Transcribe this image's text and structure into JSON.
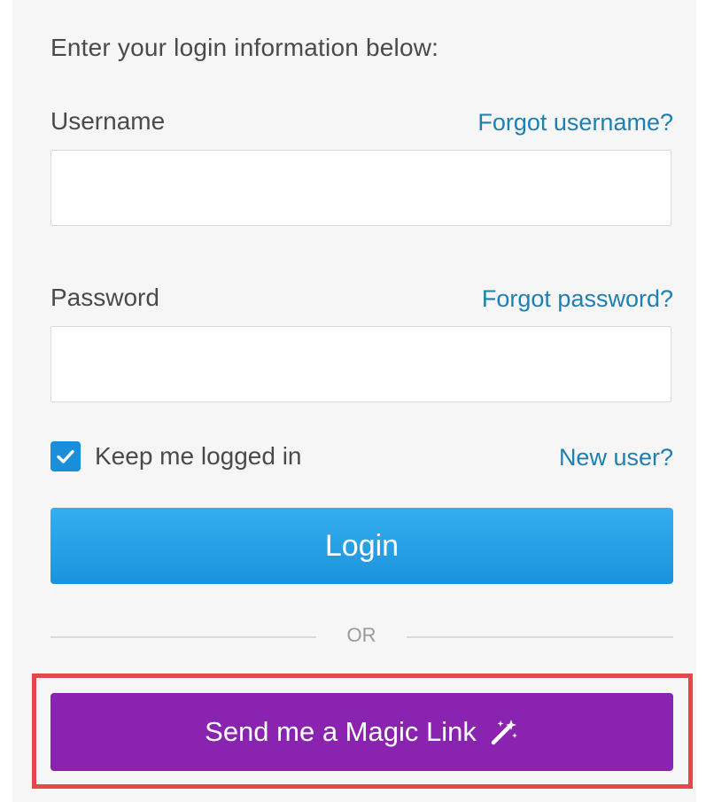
{
  "form": {
    "intro": "Enter your login information below:",
    "username": {
      "label": "Username",
      "forgot_link": "Forgot username?",
      "value": "",
      "placeholder": ""
    },
    "password": {
      "label": "Password",
      "forgot_link": "Forgot password?",
      "value": "",
      "placeholder": ""
    },
    "keep_logged_in": {
      "label": "Keep me logged in",
      "checked": true
    },
    "new_user_link": "New user?",
    "login_button": "Login",
    "divider_text": "OR",
    "magic_link_button": "Send me a Magic Link",
    "magic_icon": "magic-wand-icon"
  },
  "colors": {
    "link": "#1f7fb0",
    "login_button": "#1b93dc",
    "magic_button": "#8a24b0",
    "highlight": "#e5484a",
    "checkbox": "#1a8ed8"
  }
}
